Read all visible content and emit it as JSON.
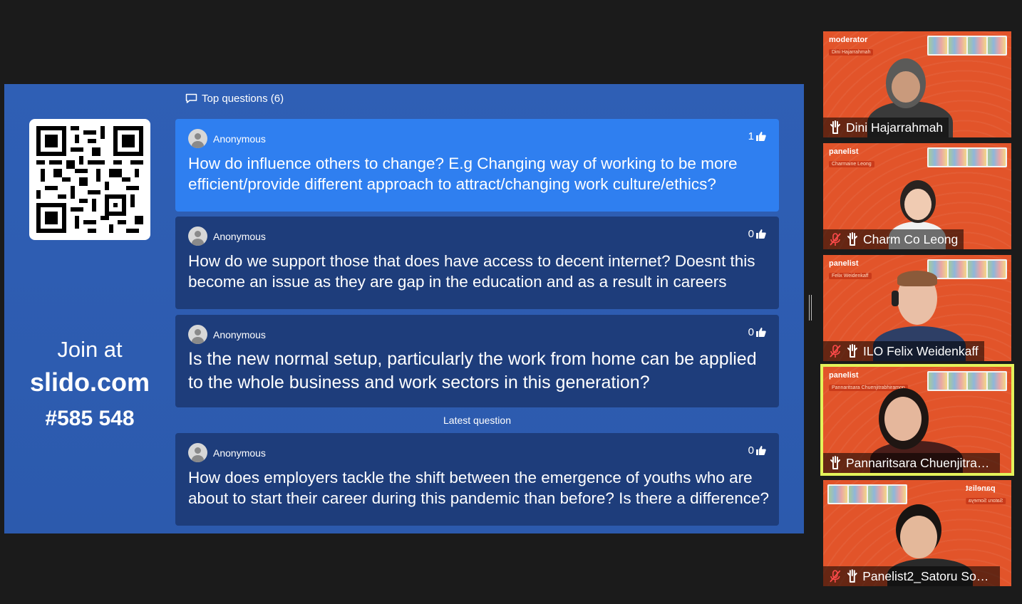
{
  "slido": {
    "top_questions_label": "Top questions (6)",
    "join": {
      "line1": "Join at",
      "site": "slido.com",
      "code": "#585 548"
    },
    "latest_label": "Latest question",
    "questions": [
      {
        "author": "Anonymous",
        "likes": "1",
        "text": "How do influence others to change? E.g Changing way of working to be more efficient/provide different approach to attract/changing work culture/ethics?"
      },
      {
        "author": "Anonymous",
        "likes": "0",
        "text": "How do we support those that does have access to decent internet? Doesnt this become an issue as they are gap in the education and as a result in careers"
      },
      {
        "author": "Anonymous",
        "likes": "0",
        "text": "Is the new normal setup, particularly the work from home can be applied to the whole business and work sectors in this generation?"
      },
      {
        "author": "Anonymous",
        "likes": "0",
        "text": "How does employers tackle the shift between the emergence of youths who are about to start their career during this pandemic than before? Is there a difference?"
      }
    ]
  },
  "participants": [
    {
      "role": "moderator",
      "tag": "Dini Hajarrahmah",
      "name": "Dini Hajarrahmah",
      "muted": false
    },
    {
      "role": "panelist",
      "tag": "Charmaine Leong",
      "name": "Charm Co Leong",
      "muted": true
    },
    {
      "role": "panelist",
      "tag": "Felix Weidenkaff",
      "name": "ILO Felix Weidenkaff",
      "muted": true
    },
    {
      "role": "panelist",
      "tag": "Pannaritsara Chuenjitrabhiramon",
      "name": "Pannaritsara Chuenjitrab...",
      "muted": false,
      "speaking": true
    },
    {
      "role": "panelist",
      "tag": "Satoru Someya",
      "name": "Panelist2_Satoru Som...",
      "muted": true
    }
  ],
  "colors": {
    "slido_bg": "#2e5db0",
    "card": "#1e3d7b",
    "card_active": "#2f7ff0",
    "tile": "#e2542a",
    "speaking": "#e4f25a"
  }
}
